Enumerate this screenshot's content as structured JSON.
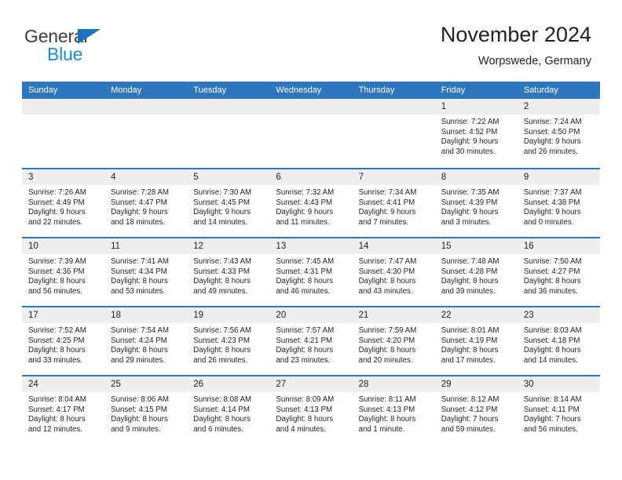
{
  "brand": {
    "name_part1": "General",
    "name_part2": "Blue",
    "triangle_icon": "triangle-icon",
    "color_dark": "#3c3c3c",
    "color_blue": "#1b8ae0"
  },
  "header": {
    "title": "November 2024",
    "subtitle": "Worpswede, Germany"
  },
  "theme": {
    "header_blue": "#2e76bd",
    "date_band_gray": "#eeeeee",
    "text": "#231f20"
  },
  "weekdays": [
    "Sunday",
    "Monday",
    "Tuesday",
    "Wednesday",
    "Thursday",
    "Friday",
    "Saturday"
  ],
  "weeks": [
    [
      {
        "day": "",
        "sunrise": "",
        "sunset": "",
        "daylight1": "",
        "daylight2": "",
        "empty": true
      },
      {
        "day": "",
        "sunrise": "",
        "sunset": "",
        "daylight1": "",
        "daylight2": "",
        "empty": true
      },
      {
        "day": "",
        "sunrise": "",
        "sunset": "",
        "daylight1": "",
        "daylight2": "",
        "empty": true
      },
      {
        "day": "",
        "sunrise": "",
        "sunset": "",
        "daylight1": "",
        "daylight2": "",
        "empty": true
      },
      {
        "day": "",
        "sunrise": "",
        "sunset": "",
        "daylight1": "",
        "daylight2": "",
        "empty": true
      },
      {
        "day": "1",
        "sunrise": "Sunrise: 7:22 AM",
        "sunset": "Sunset: 4:52 PM",
        "daylight1": "Daylight: 9 hours",
        "daylight2": "and 30 minutes."
      },
      {
        "day": "2",
        "sunrise": "Sunrise: 7:24 AM",
        "sunset": "Sunset: 4:50 PM",
        "daylight1": "Daylight: 9 hours",
        "daylight2": "and 26 minutes."
      }
    ],
    [
      {
        "day": "3",
        "sunrise": "Sunrise: 7:26 AM",
        "sunset": "Sunset: 4:49 PM",
        "daylight1": "Daylight: 9 hours",
        "daylight2": "and 22 minutes."
      },
      {
        "day": "4",
        "sunrise": "Sunrise: 7:28 AM",
        "sunset": "Sunset: 4:47 PM",
        "daylight1": "Daylight: 9 hours",
        "daylight2": "and 18 minutes."
      },
      {
        "day": "5",
        "sunrise": "Sunrise: 7:30 AM",
        "sunset": "Sunset: 4:45 PM",
        "daylight1": "Daylight: 9 hours",
        "daylight2": "and 14 minutes."
      },
      {
        "day": "6",
        "sunrise": "Sunrise: 7:32 AM",
        "sunset": "Sunset: 4:43 PM",
        "daylight1": "Daylight: 9 hours",
        "daylight2": "and 11 minutes."
      },
      {
        "day": "7",
        "sunrise": "Sunrise: 7:34 AM",
        "sunset": "Sunset: 4:41 PM",
        "daylight1": "Daylight: 9 hours",
        "daylight2": "and 7 minutes."
      },
      {
        "day": "8",
        "sunrise": "Sunrise: 7:35 AM",
        "sunset": "Sunset: 4:39 PM",
        "daylight1": "Daylight: 9 hours",
        "daylight2": "and 3 minutes."
      },
      {
        "day": "9",
        "sunrise": "Sunrise: 7:37 AM",
        "sunset": "Sunset: 4:38 PM",
        "daylight1": "Daylight: 9 hours",
        "daylight2": "and 0 minutes."
      }
    ],
    [
      {
        "day": "10",
        "sunrise": "Sunrise: 7:39 AM",
        "sunset": "Sunset: 4:36 PM",
        "daylight1": "Daylight: 8 hours",
        "daylight2": "and 56 minutes."
      },
      {
        "day": "11",
        "sunrise": "Sunrise: 7:41 AM",
        "sunset": "Sunset: 4:34 PM",
        "daylight1": "Daylight: 8 hours",
        "daylight2": "and 53 minutes."
      },
      {
        "day": "12",
        "sunrise": "Sunrise: 7:43 AM",
        "sunset": "Sunset: 4:33 PM",
        "daylight1": "Daylight: 8 hours",
        "daylight2": "and 49 minutes."
      },
      {
        "day": "13",
        "sunrise": "Sunrise: 7:45 AM",
        "sunset": "Sunset: 4:31 PM",
        "daylight1": "Daylight: 8 hours",
        "daylight2": "and 46 minutes."
      },
      {
        "day": "14",
        "sunrise": "Sunrise: 7:47 AM",
        "sunset": "Sunset: 4:30 PM",
        "daylight1": "Daylight: 8 hours",
        "daylight2": "and 43 minutes."
      },
      {
        "day": "15",
        "sunrise": "Sunrise: 7:48 AM",
        "sunset": "Sunset: 4:28 PM",
        "daylight1": "Daylight: 8 hours",
        "daylight2": "and 39 minutes."
      },
      {
        "day": "16",
        "sunrise": "Sunrise: 7:50 AM",
        "sunset": "Sunset: 4:27 PM",
        "daylight1": "Daylight: 8 hours",
        "daylight2": "and 36 minutes."
      }
    ],
    [
      {
        "day": "17",
        "sunrise": "Sunrise: 7:52 AM",
        "sunset": "Sunset: 4:25 PM",
        "daylight1": "Daylight: 8 hours",
        "daylight2": "and 33 minutes."
      },
      {
        "day": "18",
        "sunrise": "Sunrise: 7:54 AM",
        "sunset": "Sunset: 4:24 PM",
        "daylight1": "Daylight: 8 hours",
        "daylight2": "and 29 minutes."
      },
      {
        "day": "19",
        "sunrise": "Sunrise: 7:56 AM",
        "sunset": "Sunset: 4:23 PM",
        "daylight1": "Daylight: 8 hours",
        "daylight2": "and 26 minutes."
      },
      {
        "day": "20",
        "sunrise": "Sunrise: 7:57 AM",
        "sunset": "Sunset: 4:21 PM",
        "daylight1": "Daylight: 8 hours",
        "daylight2": "and 23 minutes."
      },
      {
        "day": "21",
        "sunrise": "Sunrise: 7:59 AM",
        "sunset": "Sunset: 4:20 PM",
        "daylight1": "Daylight: 8 hours",
        "daylight2": "and 20 minutes."
      },
      {
        "day": "22",
        "sunrise": "Sunrise: 8:01 AM",
        "sunset": "Sunset: 4:19 PM",
        "daylight1": "Daylight: 8 hours",
        "daylight2": "and 17 minutes."
      },
      {
        "day": "23",
        "sunrise": "Sunrise: 8:03 AM",
        "sunset": "Sunset: 4:18 PM",
        "daylight1": "Daylight: 8 hours",
        "daylight2": "and 14 minutes."
      }
    ],
    [
      {
        "day": "24",
        "sunrise": "Sunrise: 8:04 AM",
        "sunset": "Sunset: 4:17 PM",
        "daylight1": "Daylight: 8 hours",
        "daylight2": "and 12 minutes."
      },
      {
        "day": "25",
        "sunrise": "Sunrise: 8:06 AM",
        "sunset": "Sunset: 4:15 PM",
        "daylight1": "Daylight: 8 hours",
        "daylight2": "and 9 minutes."
      },
      {
        "day": "26",
        "sunrise": "Sunrise: 8:08 AM",
        "sunset": "Sunset: 4:14 PM",
        "daylight1": "Daylight: 8 hours",
        "daylight2": "and 6 minutes."
      },
      {
        "day": "27",
        "sunrise": "Sunrise: 8:09 AM",
        "sunset": "Sunset: 4:13 PM",
        "daylight1": "Daylight: 8 hours",
        "daylight2": "and 4 minutes."
      },
      {
        "day": "28",
        "sunrise": "Sunrise: 8:11 AM",
        "sunset": "Sunset: 4:13 PM",
        "daylight1": "Daylight: 8 hours",
        "daylight2": "and 1 minute."
      },
      {
        "day": "29",
        "sunrise": "Sunrise: 8:12 AM",
        "sunset": "Sunset: 4:12 PM",
        "daylight1": "Daylight: 7 hours",
        "daylight2": "and 59 minutes."
      },
      {
        "day": "30",
        "sunrise": "Sunrise: 8:14 AM",
        "sunset": "Sunset: 4:11 PM",
        "daylight1": "Daylight: 7 hours",
        "daylight2": "and 56 minutes."
      }
    ]
  ]
}
